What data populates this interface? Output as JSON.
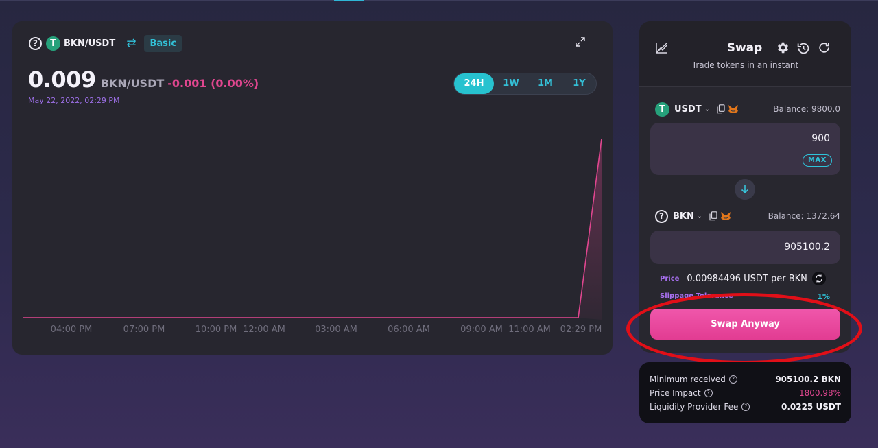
{
  "chart_panel": {
    "pair_label": "BKN/USDT",
    "basic_label": "Basic",
    "price_value": "0.009",
    "price_pair": "BKN/USDT",
    "price_change": "-0.001 (0.00%)",
    "timestamp": "May 22, 2022, 02:29 PM",
    "range_tabs": [
      {
        "label": "24H",
        "active": true
      },
      {
        "label": "1W",
        "active": false
      },
      {
        "label": "1M",
        "active": false
      },
      {
        "label": "1Y",
        "active": false
      }
    ]
  },
  "chart_data": {
    "type": "area",
    "x_tick_labels": [
      "04:00 PM",
      "07:00 PM",
      "10:00 PM",
      "12:00 AM",
      "03:00 AM",
      "06:00 AM",
      "09:00 AM",
      "11:00 AM",
      "02:29 PM"
    ],
    "x": [
      "02:29 PM",
      "04:00 PM",
      "07:00 PM",
      "10:00 PM",
      "12:00 AM",
      "03:00 AM",
      "06:00 AM",
      "09:00 AM",
      "11:00 AM",
      "02:05 PM",
      "02:29 PM"
    ],
    "values": [
      0.0001,
      0.0001,
      0.0001,
      0.0001,
      0.0001,
      0.0001,
      0.0001,
      0.0001,
      0.0001,
      0.0001,
      0.009
    ],
    "ylim": [
      0,
      0.0104
    ],
    "line_color": "#e0468f",
    "title": "",
    "xlabel": "",
    "ylabel": "",
    "grid": false
  },
  "swap": {
    "title": "Swap",
    "subtitle": "Trade tokens in an instant",
    "from": {
      "token": "USDT",
      "balance": "Balance: 9800.0",
      "amount": "900",
      "max_label": "MAX"
    },
    "to": {
      "token": "BKN",
      "balance": "Balance: 1372.64",
      "amount": "905100.2"
    },
    "price_label": "Price",
    "price_value": "0.00984496 USDT per BKN",
    "slippage_label": "Slippage Tolerance",
    "slippage_value": "1%",
    "button_label": "Swap Anyway"
  },
  "details": {
    "min_received_label": "Minimum received",
    "min_received_value": "905100.2 BKN",
    "price_impact_label": "Price Impact",
    "price_impact_value": "1800.98%",
    "lp_fee_label": "Liquidity Provider Fee",
    "lp_fee_value": "0.0225 USDT"
  },
  "colors": {
    "accent_teal": "#2ec3da",
    "accent_pink": "#e0468f",
    "accent_purple": "#a870f0",
    "annotation_red": "#e10f18"
  },
  "icons": {
    "help": "?",
    "tether": "T",
    "question_small": "?"
  }
}
